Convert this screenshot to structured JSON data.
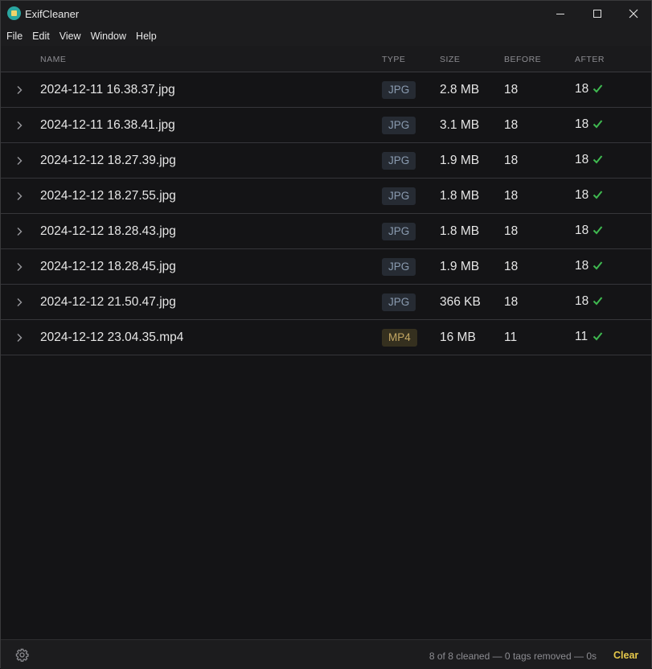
{
  "window": {
    "title": "ExifCleaner",
    "icons": {
      "app": "exifcleaner-app-icon",
      "minimize": "minimize-icon",
      "maximize": "maximize-icon",
      "close": "close-icon"
    }
  },
  "menu": [
    "File",
    "Edit",
    "View",
    "Window",
    "Help"
  ],
  "table": {
    "headers": {
      "name": "NAME",
      "type": "TYPE",
      "size": "SIZE",
      "before": "BEFORE",
      "after": "AFTER"
    },
    "rows": [
      {
        "name": "2024-12-11 16.38.37.jpg",
        "type": "JPG",
        "size": "2.8 MB",
        "before": "18",
        "after": "18"
      },
      {
        "name": "2024-12-11 16.38.41.jpg",
        "type": "JPG",
        "size": "3.1 MB",
        "before": "18",
        "after": "18"
      },
      {
        "name": "2024-12-12 18.27.39.jpg",
        "type": "JPG",
        "size": "1.9 MB",
        "before": "18",
        "after": "18"
      },
      {
        "name": "2024-12-12 18.27.55.jpg",
        "type": "JPG",
        "size": "1.8 MB",
        "before": "18",
        "after": "18"
      },
      {
        "name": "2024-12-12 18.28.43.jpg",
        "type": "JPG",
        "size": "1.8 MB",
        "before": "18",
        "after": "18"
      },
      {
        "name": "2024-12-12 18.28.45.jpg",
        "type": "JPG",
        "size": "1.9 MB",
        "before": "18",
        "after": "18"
      },
      {
        "name": "2024-12-12 21.50.47.jpg",
        "type": "JPG",
        "size": "366 KB",
        "before": "18",
        "after": "18"
      },
      {
        "name": "2024-12-12 23.04.35.mp4",
        "type": "MP4",
        "size": "16 MB",
        "before": "11",
        "after": "11"
      }
    ]
  },
  "footer": {
    "status": "8 of 8 cleaned — 0 tags removed — 0s",
    "clear_label": "Clear"
  },
  "colors": {
    "background": "#141416",
    "accent_clear": "#e5c84a",
    "check_green": "#3fb950",
    "badge_jpg": "#8a9bb0",
    "badge_mp4": "#c4a763"
  }
}
